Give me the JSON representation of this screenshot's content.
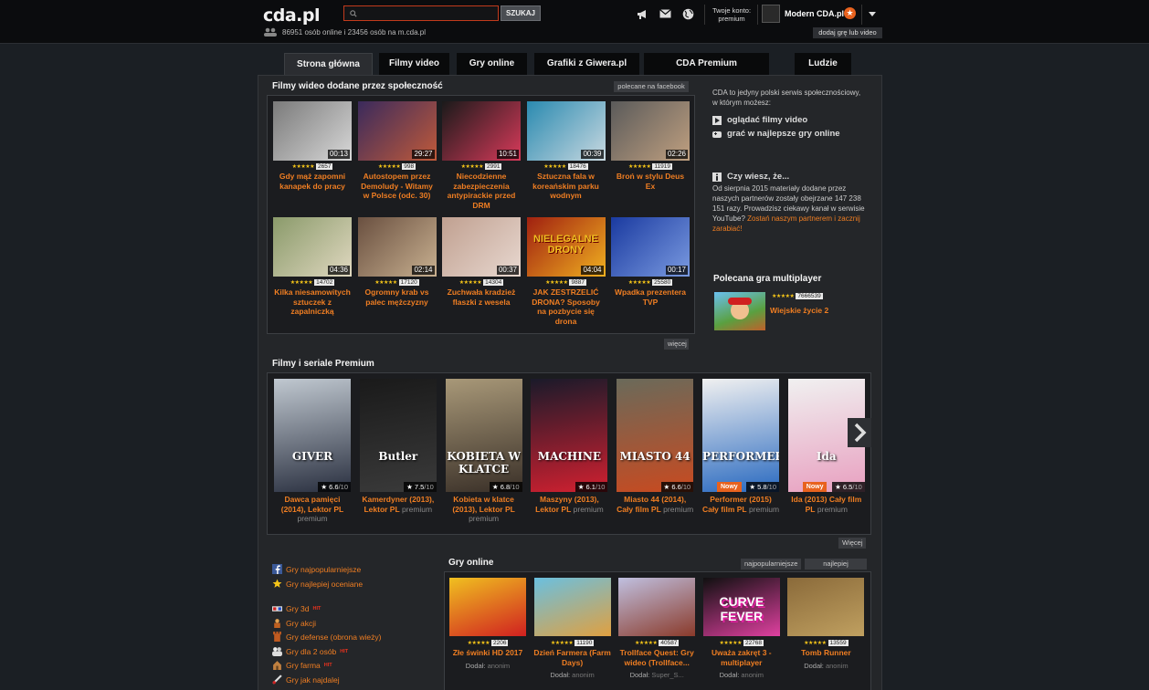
{
  "header": {
    "logo": "cda.pl",
    "search_button": "SZUKAJ",
    "online_text": "86951 osób online i 23456 osób na m.cda.pl",
    "account_line1": "Twoje konto:",
    "account_line2": "premium",
    "username": "Modern CDA.pl",
    "add_button": "dodaj grę lub video"
  },
  "tabs": [
    "Strona główna",
    "Filmy video",
    "Gry online",
    "Grafiki z Giwera.pl",
    "CDA Premium",
    "Ludzie"
  ],
  "community": {
    "title": "Filmy wideo dodane przez społeczność",
    "facebook_btn": "polecane na facebook",
    "more_btn": "więcej",
    "videos": [
      {
        "duration": "00:13",
        "views": "2657",
        "title": "Gdy mąż zapomni kanapek do pracy",
        "stars": "★★★★★",
        "c1": "#7a7a7a",
        "c2": "#d8d8d8"
      },
      {
        "duration": "29:27",
        "views": "998",
        "title": "Autostopem przez Demoludy - Witamy w Polsce (odc. 30)",
        "stars": "★★★★★",
        "c1": "#3a2a5c",
        "c2": "#c05a3a"
      },
      {
        "duration": "10:51",
        "views": "2991",
        "title": "Niecodzienne zabezpieczenia antypirackie przed DRM",
        "stars": "★★★★★",
        "c1": "#1a1a1a",
        "c2": "#d83a5a"
      },
      {
        "duration": "00:39",
        "views": "18476",
        "title": "Sztuczna fala w koreańskim parku wodnym",
        "stars": "★★★★★",
        "c1": "#2a8ab0",
        "c2": "#c8d8e0"
      },
      {
        "duration": "02:26",
        "views": "11919",
        "title": "Broń w stylu Deus Ex",
        "stars": "★★★★★",
        "c1": "#5a5a5a",
        "c2": "#c0a080"
      },
      {
        "duration": "04:36",
        "views": "14702",
        "title": "Kilka niesamowitych sztuczek z zapalniczką",
        "stars": "★★★★★",
        "c1": "#8a9a6a",
        "c2": "#e0d8c0"
      },
      {
        "duration": "02:14",
        "views": "17120",
        "title": "Ogromny krab vs palec mężczyzny",
        "stars": "★★★★★",
        "c1": "#6a5040",
        "c2": "#c8b090"
      },
      {
        "duration": "00:37",
        "views": "14304",
        "title": "Zuchwała kradzież flaszki z wesela",
        "stars": "★★★★★",
        "c1": "#c0a090",
        "c2": "#e8d8d0"
      },
      {
        "duration": "04:04",
        "views": "9887",
        "title": "JAK ZESTRZELIĆ DRONA? Sposoby na pozbycie się drona",
        "stars": "★★★★★",
        "c1": "#a02010",
        "c2": "#f0b020",
        "label": "NIELEGALNE DRONY"
      },
      {
        "duration": "00:17",
        "views": "25580",
        "title": "Wpadka prezentera TVP",
        "stars": "★★★★★",
        "c1": "#1a3aa0",
        "c2": "#7a9ae0"
      }
    ]
  },
  "sidebar": {
    "intro": "CDA to jedyny polski serwis społecznościowy, w którym możesz:",
    "link1": "oglądać filmy video",
    "link2": "grać w najlepsze gry online",
    "did_you_know_title": "Czy wiesz, że...",
    "did_you_know_text": "Od sierpnia 2015 materiały dodane przez naszych partnerów zostały obejrzane 147 238 151 razy. Prowadzisz ciekawy kanał w serwisie YouTube?",
    "did_you_know_link": "Zostań naszym partnerem i zacznij zarabiać!",
    "multiplayer_title": "Polecana gra multiplayer",
    "mp_views": "7666539",
    "mp_game": "Wiejskie życie 2",
    "mp_stars": "★★★★★"
  },
  "premium": {
    "title": "Filmy i seriale Premium",
    "more_btn": "Więcej",
    "movies": [
      {
        "rating": "★ 6.6",
        "scale": "/10",
        "title": "Dawca pamięci (2014), Lektor PL",
        "tag": "premium",
        "nowy": "",
        "c1": "#c0c8d0",
        "c2": "#2a3040",
        "label": "GIVER"
      },
      {
        "rating": "★ 7.5",
        "scale": "/10",
        "title": "Kamerdyner (2013), Lektor PL",
        "tag": "premium",
        "nowy": "",
        "c1": "#1a1a1a",
        "c2": "#3a3a3a",
        "label": "Butler"
      },
      {
        "rating": "★ 6.8",
        "scale": "/10",
        "title": "Kobieta w klatce (2013), Lektor PL",
        "tag": "premium",
        "nowy": "",
        "c1": "#a89878",
        "c2": "#3a3028",
        "label": "KOBIETA W KLATCE"
      },
      {
        "rating": "★ 6.1",
        "scale": "/10",
        "title": "Maszyny (2013), Lektor PL",
        "tag": "premium",
        "nowy": "",
        "c1": "#1a1a2a",
        "c2": "#d02030",
        "label": "MACHINE"
      },
      {
        "rating": "★ 6.6",
        "scale": "/10",
        "title": "Miasto 44 (2014), Cały film PL",
        "tag": "premium",
        "nowy": "",
        "c1": "#6a6a5a",
        "c2": "#c84a20",
        "label": "MIASTO 44"
      },
      {
        "rating": "★ 5.8",
        "scale": "/10",
        "title": "Performer (2015) Cały film PL",
        "tag": "premium",
        "nowy": "Nowy",
        "c1": "#f0f0f0",
        "c2": "#2a6ac0",
        "label": "PERFORMER"
      },
      {
        "rating": "★ 6.5",
        "scale": "/10",
        "title": "Ida (2013) Cały film PL",
        "tag": "premium",
        "nowy": "Nowy",
        "c1": "#f0f0f0",
        "c2": "#e8a0c0",
        "label": "Ida"
      }
    ]
  },
  "game_categories": [
    {
      "label": "Gry najpopularniejsze",
      "icon": "facebook-icon",
      "hit": ""
    },
    {
      "label": "Gry najlepiej oceniane",
      "icon": "star-icon",
      "hit": ""
    },
    {
      "label": "Gry 3d",
      "icon": "3d-glasses-icon",
      "hit": "HIT"
    },
    {
      "label": "Gry akcji",
      "icon": "action-icon",
      "hit": ""
    },
    {
      "label": "Gry defense (obrona wieży)",
      "icon": "tower-icon",
      "hit": ""
    },
    {
      "label": "Gry dla 2 osób",
      "icon": "two-players-icon",
      "hit": "HIT"
    },
    {
      "label": "Gry farma",
      "icon": "farm-icon",
      "hit": "HIT"
    },
    {
      "label": "Gry jak najdalej",
      "icon": "distance-icon",
      "hit": ""
    }
  ],
  "games": {
    "title": "Gry online",
    "btn_popular": "najpopularniejsze",
    "btn_best": "najlepiej oceniane",
    "added_label": "Dodał:",
    "items": [
      {
        "views": "2206",
        "title": "Złe świnki HD 2017",
        "author": "anonim",
        "c1": "#f0c020",
        "c2": "#d02020",
        "stars": "★★★★★"
      },
      {
        "views": "11190",
        "title": "Dzień Farmera (Farm Days)",
        "author": "anonim",
        "c1": "#6ac0e0",
        "c2": "#e0a040",
        "stars": "★★★★★"
      },
      {
        "views": "40587",
        "title": "Trollface Quest: Gry wideo (Trollface...",
        "author": "Super_S...",
        "c1": "#c0c0e0",
        "c2": "#8a3a2a",
        "stars": "★★★★★"
      },
      {
        "views": "22768",
        "title": "Uważa zakręt 3 - multiplayer",
        "author": "anonim",
        "c1": "#101010",
        "c2": "#e040a0",
        "label": "CURVE FEVER",
        "stars": "★★★★★"
      },
      {
        "views": "13559",
        "title": "Tomb Runner",
        "author": "anonim",
        "c1": "#8a6a3a",
        "c2": "#c0a060",
        "stars": "★★★★★"
      }
    ]
  },
  "colors": {
    "accent": "#f07e22",
    "background": "#1b1f24",
    "search_border": "#c23a1c"
  }
}
